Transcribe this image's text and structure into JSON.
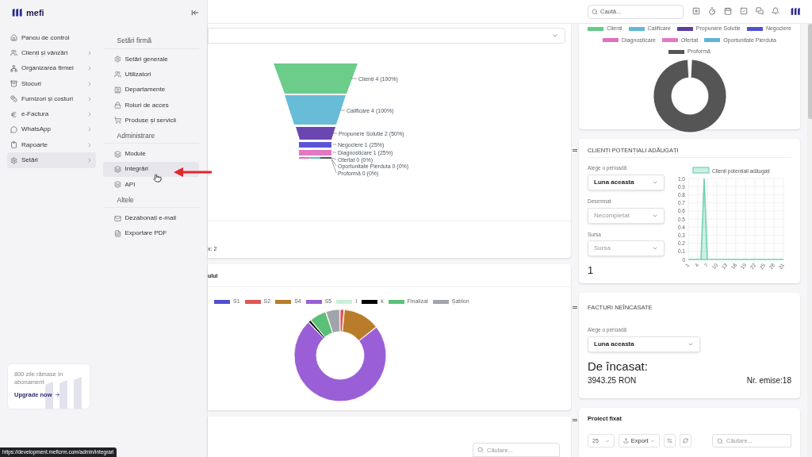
{
  "sidebar": {
    "brand": "mefi",
    "nav": [
      {
        "label": "Panou de control",
        "has_submenu": false,
        "selected": false
      },
      {
        "label": "Clienți și vânzări",
        "has_submenu": true,
        "selected": false
      },
      {
        "label": "Organizarea firmei",
        "has_submenu": true,
        "selected": false
      },
      {
        "label": "Stocuri",
        "has_submenu": true,
        "selected": false
      },
      {
        "label": "Furnizori și costuri",
        "has_submenu": true,
        "selected": false
      },
      {
        "label": "e-Factura",
        "has_submenu": true,
        "selected": false
      },
      {
        "label": "WhatsApp",
        "has_submenu": true,
        "selected": false
      },
      {
        "label": "Rapoarte",
        "has_submenu": true,
        "selected": false
      },
      {
        "label": "Setări",
        "has_submenu": true,
        "selected": true
      }
    ],
    "submenu": [
      {
        "title": "Setări firmă",
        "items": [
          {
            "label": "Setări generale",
            "selected": false
          },
          {
            "label": "Utilizatori",
            "selected": false
          },
          {
            "label": "Departamente",
            "selected": false
          },
          {
            "label": "Roluri de acces",
            "selected": false
          },
          {
            "label": "Produse și servicii",
            "selected": false
          }
        ]
      },
      {
        "title": "Administrare",
        "items": [
          {
            "label": "Module",
            "selected": false
          },
          {
            "label": "Integrări",
            "selected": true
          },
          {
            "label": "API",
            "selected": false
          }
        ]
      },
      {
        "title": "Altele",
        "items": [
          {
            "label": "Dezabonați e-mail",
            "selected": false
          },
          {
            "label": "Exportare PDF",
            "selected": false
          }
        ]
      }
    ],
    "upgrade": {
      "text": "800 zile rămase în abonament",
      "link": "Upgrade now"
    }
  },
  "status_url": "https://development.meficrm.com/admin/integrari",
  "topbar": {
    "search_placeholder": "Caută..."
  },
  "funnel": {
    "stages": [
      {
        "label": "Clienți 4 (100%)",
        "color": "#6ccc8a"
      },
      {
        "label": "Calificare 4 (100%)",
        "color": "#68bcd8"
      },
      {
        "label": "Propunere Solutie 2 (50%)",
        "color": "#6a47b0"
      },
      {
        "label": "Negociere 1 (25%)",
        "color": "#5a55d8"
      },
      {
        "label": "Diagnosticare 1 (25%)",
        "color": "#e378c4"
      },
      {
        "label": "Ofertat 0 (0%)",
        "color": "#e070c0"
      },
      {
        "label": "Oportunitate Pierduta 0 (0%)",
        "color": "#62b8d8"
      },
      {
        "label": "Proformă 0 (0%)",
        "color": "#555555"
      }
    ]
  },
  "center_fragment": "x: 2",
  "status_card": {
    "title": "ului",
    "legend": [
      {
        "label": "S1",
        "color": "#5050d0"
      },
      {
        "label": "S2",
        "color": "#e05555"
      },
      {
        "label": "S4",
        "color": "#b87c2a"
      },
      {
        "label": "S5",
        "color": "#9a5fd6"
      },
      {
        "label": "I",
        "color": "#c8f0d8"
      },
      {
        "label": "k",
        "color": "#000000"
      },
      {
        "label": "Finalizat",
        "color": "#5cbf78"
      },
      {
        "label": "Șablon",
        "color": "#a0a4ab"
      }
    ]
  },
  "table_card": {
    "search_placeholder": "Căutare..."
  },
  "pipeline_card": {
    "legend": [
      {
        "label": "Clienți",
        "color": "#66c987"
      },
      {
        "label": "Calificare",
        "color": "#62b8d8"
      },
      {
        "label": "Propunere Solutie",
        "color": "#5a3fa0"
      },
      {
        "label": "Negociere",
        "color": "#5050d0"
      },
      {
        "label": "Diagnosticare",
        "color": "#e070c0"
      },
      {
        "label": "Ofertat",
        "color": "#e378c4"
      },
      {
        "label": "Oportunitate Pierduta",
        "color": "#5eb4d4"
      },
      {
        "label": "Proformă",
        "color": "#555555"
      }
    ]
  },
  "leads_card": {
    "title": "CLIENȚI POTENȚIALI ADĂUGAȚI",
    "fields": [
      {
        "label": "Alege o perioadă",
        "value": "Luna aceasta"
      },
      {
        "label": "Desemnat",
        "placeholder": "Necompletat"
      },
      {
        "label": "Sursa",
        "placeholder": "Sursa"
      }
    ],
    "count": "1",
    "chart_data": {
      "type": "area",
      "x": [
        1,
        2,
        3,
        4,
        5,
        6,
        7,
        8,
        9,
        10,
        11,
        12,
        13,
        14,
        15,
        16,
        17,
        18,
        19,
        20,
        21,
        22,
        23,
        24,
        25,
        26,
        27,
        28,
        29,
        30,
        31
      ],
      "series": [
        {
          "name": "Clienți potențiali adăugați",
          "color": "#6fd3b0",
          "values": [
            0,
            0,
            0,
            0,
            0,
            1,
            0,
            0,
            0,
            0,
            0,
            0,
            0,
            0,
            0,
            0,
            0,
            0,
            0,
            0,
            0,
            0,
            0,
            0,
            0,
            0,
            0,
            0,
            0,
            0,
            0
          ]
        }
      ],
      "xticks": [
        1,
        4,
        7,
        10,
        13,
        16,
        19,
        22,
        25,
        28,
        31
      ],
      "xlim": [
        1,
        31
      ],
      "grid": true,
      "yticks": [
        0,
        0.1,
        0.2,
        0.3,
        0.4,
        0.5,
        0.6,
        0.7,
        0.8,
        0.9,
        {
          "value": 1,
          "label": "1.0"
        }
      ],
      "ylim": [
        0,
        1
      ]
    }
  },
  "invoices_card": {
    "title": "FACTURI NEÎNCASATE",
    "period": {
      "label": "Alege o perioadă",
      "value": "Luna aceasta"
    },
    "heading": "De încasat:",
    "amount": "3943.25 RON",
    "issued": "Nr. emise:18"
  },
  "project_card": {
    "title": "Proiect fixat",
    "page_size": "25",
    "export": "Export",
    "search_placeholder": "Căutare..."
  }
}
